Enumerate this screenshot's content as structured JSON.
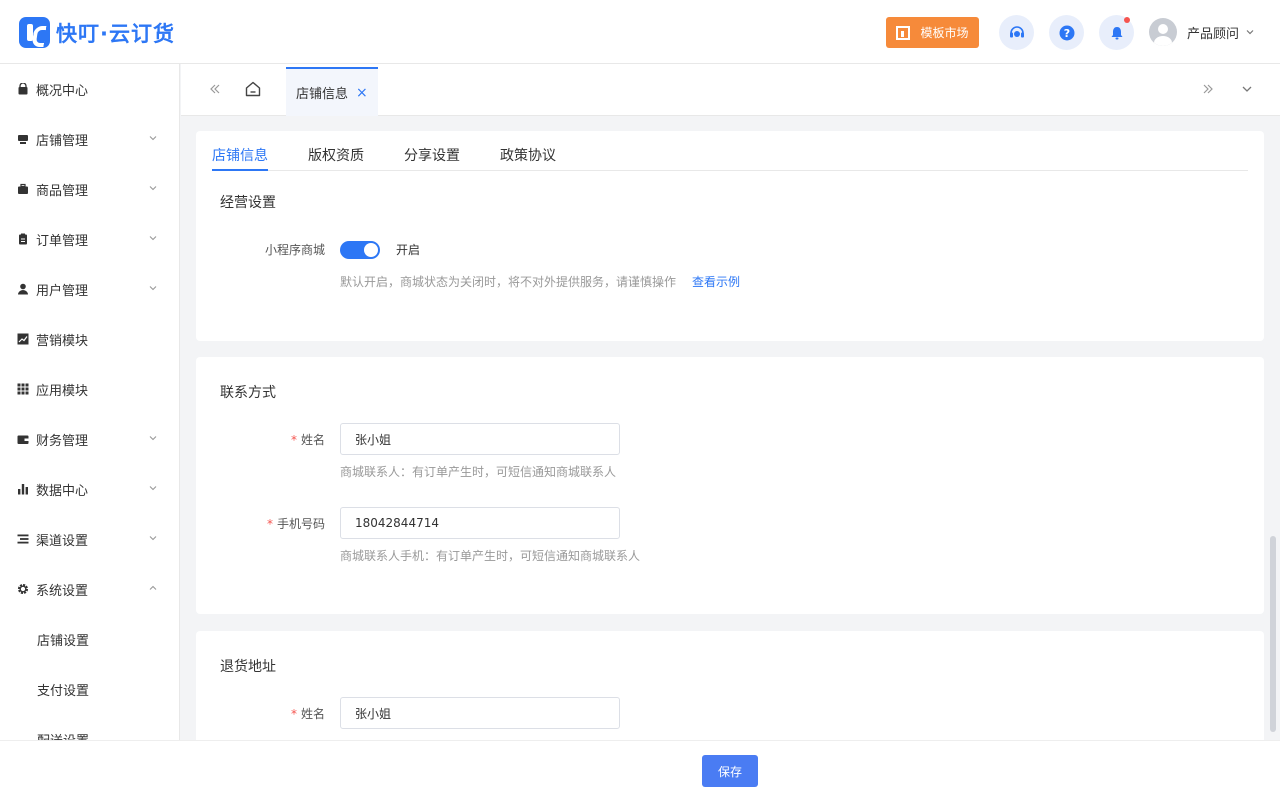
{
  "app": {
    "logo_text": "快叮·云订货"
  },
  "header": {
    "market_button": "模板市场",
    "user_name": "产品顾问"
  },
  "sidebar": {
    "items": [
      {
        "label": "概况中心",
        "icon": "bag-icon",
        "expandable": false
      },
      {
        "label": "店铺管理",
        "icon": "store-icon",
        "expandable": true
      },
      {
        "label": "商品管理",
        "icon": "briefcase-icon",
        "expandable": true
      },
      {
        "label": "订单管理",
        "icon": "clipboard-icon",
        "expandable": true
      },
      {
        "label": "用户管理",
        "icon": "user-icon",
        "expandable": true
      },
      {
        "label": "营销模块",
        "icon": "trend-chart-icon",
        "expandable": false
      },
      {
        "label": "应用模块",
        "icon": "grid-icon",
        "expandable": false
      },
      {
        "label": "财务管理",
        "icon": "wallet-icon",
        "expandable": true
      },
      {
        "label": "数据中心",
        "icon": "bar-chart-icon",
        "expandable": true
      },
      {
        "label": "渠道设置",
        "icon": "list-icon",
        "expandable": true
      },
      {
        "label": "系统设置",
        "icon": "gear-icon",
        "expandable": true,
        "expanded": true
      }
    ],
    "sub_items": [
      "店铺设置",
      "支付设置",
      "配送设置"
    ]
  },
  "tabbar": {
    "active_tab": "店铺信息",
    "close_glyph": "×"
  },
  "sub_tabs": [
    "店铺信息",
    "版权资质",
    "分享设置",
    "政策协议"
  ],
  "business": {
    "title": "经营设置",
    "mini_program_label": "小程序商城",
    "toggle_on": true,
    "toggle_text": "开启",
    "help": "默认开启，商城状态为关闭时，将不对外提供服务，请谨慎操作",
    "example_link": "查看示例"
  },
  "contact": {
    "title": "联系方式",
    "name_label": "姓名",
    "name_value": "张小姐",
    "name_help": "商城联系人：有订单产生时，可短信通知商城联系人",
    "phone_label": "手机号码",
    "phone_value": "18042844714",
    "phone_help": "商城联系人手机：有订单产生时，可短信通知商城联系人",
    "required_mark": "*"
  },
  "return_address": {
    "title": "退货地址",
    "name_label": "姓名",
    "name_value": "张小姐",
    "required_mark": "*"
  },
  "footer": {
    "save_label": "保存"
  },
  "colors": {
    "primary": "#2d77f5",
    "market": "#f68a3a",
    "required": "#f5544f"
  }
}
